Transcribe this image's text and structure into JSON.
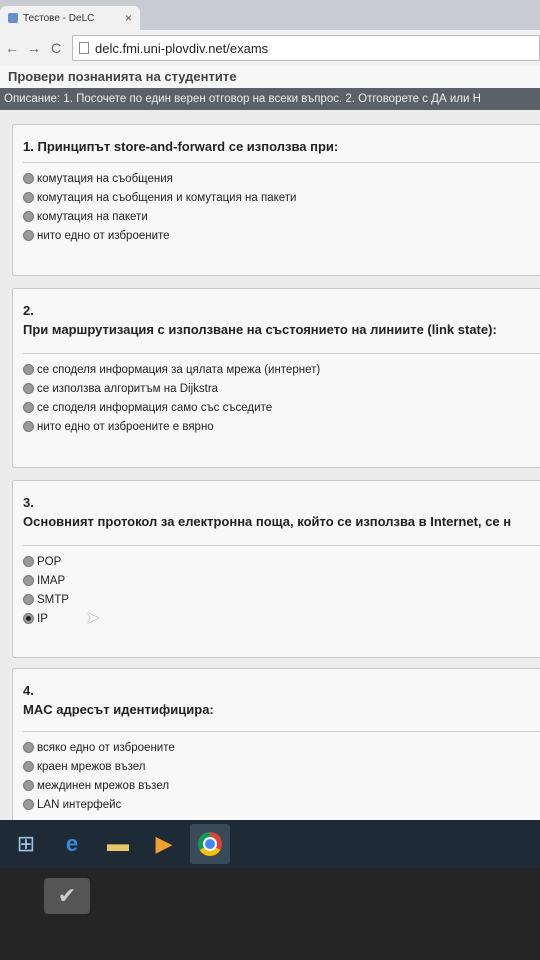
{
  "browser": {
    "tab_title": "Тестове - DeLC",
    "url": "delc.fmi.uni-plovdiv.net/exams"
  },
  "page": {
    "header_fragment": "Провери познанията на студентите",
    "description": "Описание: 1. Посочете по един верен отговор на всеки въпрос. 2. Отговорете с ДА или Н"
  },
  "questions": [
    {
      "number": "1.",
      "text": "Принципът store-and-forward се използва при:",
      "options": [
        "комутация на съобщения",
        "комутация на съобщения и комутация на пакети",
        "комутация на пакети",
        "нито едно от изброените"
      ]
    },
    {
      "number": "2.",
      "text": "При маршрутизация с използване на състоянието на линиите (link state):",
      "options": [
        "се споделя информация за цялата мрежа (интернет)",
        "се използва алгоритъм на  Dijkstra",
        "се споделя информация само със съседите",
        "нито едно от изброените е вярно"
      ]
    },
    {
      "number": "3.",
      "text": "Основният протокол за електронна поща, който се използва в Internet, се н",
      "options": [
        "POP",
        "IMAP",
        "SMTP",
        "IP"
      ],
      "selected_index": 3
    },
    {
      "number": "4.",
      "text": "MAC адресът идентифицира:",
      "options": [
        "всяко едно от изброените",
        "краен мрежов възел",
        "междинен мрежов възел",
        "LAN интерфейс"
      ]
    }
  ],
  "taskbar": {
    "items": [
      "start-button",
      "internet-explorer",
      "file-explorer",
      "media-player",
      "google-chrome"
    ]
  }
}
